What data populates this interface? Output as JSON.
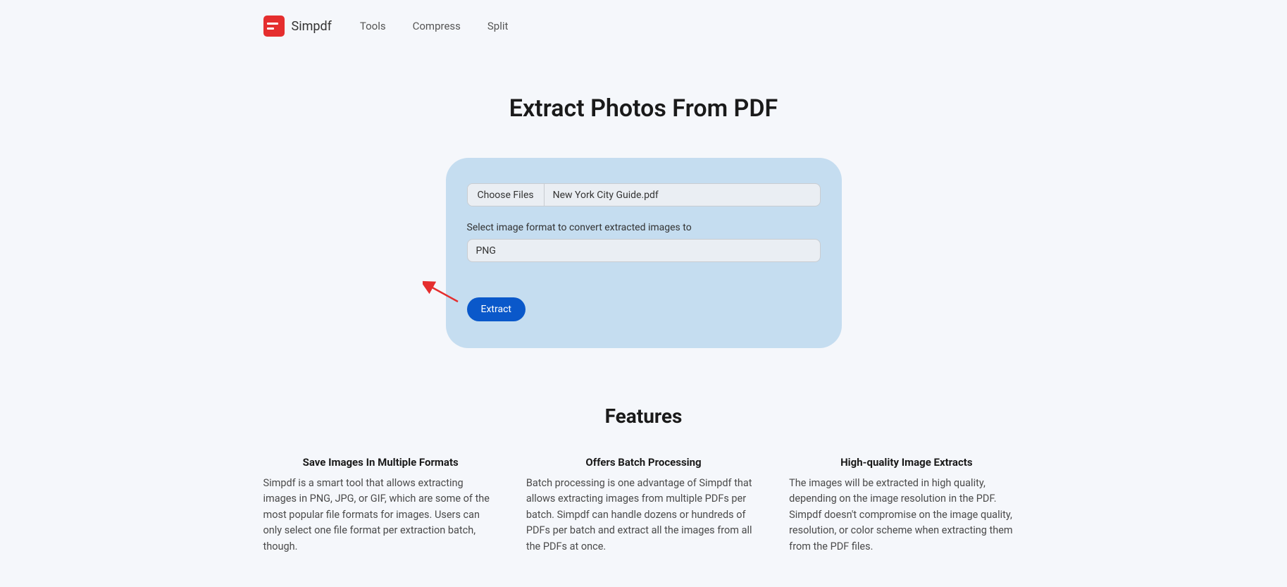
{
  "header": {
    "brand": "Simpdf",
    "nav": {
      "tools": "Tools",
      "compress": "Compress",
      "split": "Split"
    }
  },
  "page": {
    "title": "Extract Photos From PDF"
  },
  "upload": {
    "chooseFilesLabel": "Choose Files",
    "selectedFile": "New York City Guide.pdf",
    "formatLabel": "Select image format to convert extracted images to",
    "formatValue": "PNG",
    "extractLabel": "Extract"
  },
  "features": {
    "title": "Features",
    "cols": [
      {
        "heading": "Save Images In Multiple Formats",
        "desc": "Simpdf is a smart tool that allows extracting images in PNG, JPG, or GIF, which are some of the most popular file formats for images. Users can only select one file format per extraction batch, though."
      },
      {
        "heading": "Offers Batch Processing",
        "desc": "Batch processing is one advantage of Simpdf that allows extracting images from multiple PDFs per batch. Simpdf can handle dozens or hundreds of PDFs per batch and extract all the images from all the PDFs at once."
      },
      {
        "heading": "High-quality Image Extracts",
        "desc": "The images will be extracted in high quality, depending on the image resolution in the PDF. Simpdf doesn't compromise on the image quality, resolution, or color scheme when extracting them from the PDF files."
      }
    ]
  }
}
